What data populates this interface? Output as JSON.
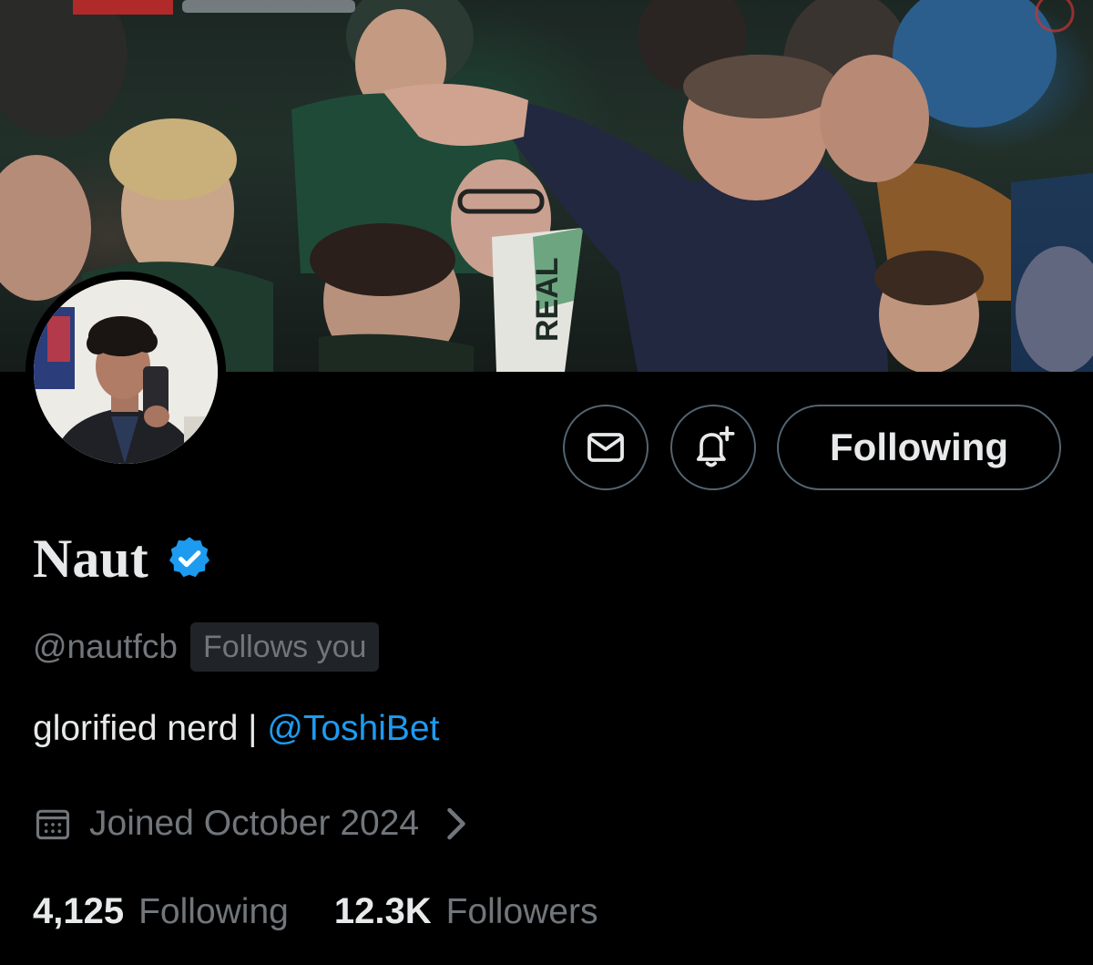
{
  "profile": {
    "display_name": "Naut",
    "handle": "@nautfcb",
    "follows_you_badge": "Follows you",
    "bio_text": "glorified nerd | ",
    "bio_mention": "@ToshiBet",
    "joined": "Joined October 2024",
    "verified": true
  },
  "actions": {
    "following_button": "Following",
    "message_icon": "envelope-icon",
    "notify_icon": "bell-plus-icon"
  },
  "stats": {
    "following_count": "4,125",
    "following_label": "Following",
    "followers_count": "12.3K",
    "followers_label": "Followers"
  },
  "banner": {
    "scarf_text": "REAL"
  },
  "colors": {
    "background": "#000000",
    "text_primary": "#e7e9ea",
    "text_secondary": "#71767b",
    "accent_blue": "#1d9bf0",
    "border": "#536471"
  }
}
